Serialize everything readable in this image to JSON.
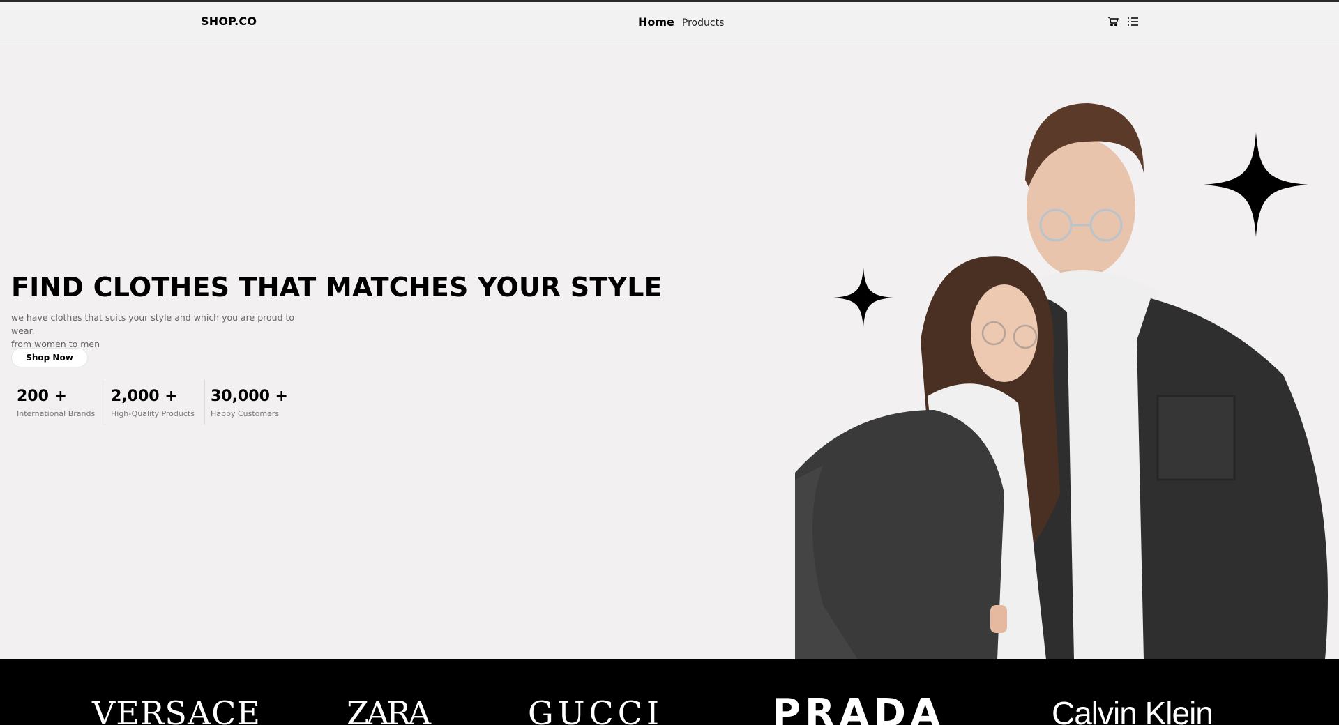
{
  "nav": {
    "brand": "SHOP.CO",
    "links": [
      {
        "label": "Home",
        "active": true
      },
      {
        "label": "Products",
        "active": false
      }
    ],
    "icons": [
      "cart-icon",
      "list-icon"
    ]
  },
  "hero": {
    "title": "FIND CLOTHES THAT MATCHES YOUR STYLE",
    "subtitle_line1": "we have clothes that suits your style and which you are proud to wear.",
    "subtitle_line2": "from women to men",
    "cta_label": "Shop Now",
    "stats": [
      {
        "value": "200 +",
        "label": "International Brands"
      },
      {
        "value": "2,000 +",
        "label": "High-Quality Products"
      },
      {
        "value": "30,000 +",
        "label": "Happy Customers"
      }
    ],
    "decorations": [
      "sparkle-icon",
      "sparkle-icon"
    ]
  },
  "brands": [
    "VERSACE",
    "ZARA",
    "GUCCI",
    "PRADA",
    "Calvin Klein"
  ],
  "colors": {
    "page_bg": "#f2f0f1",
    "nav_bg": "#f2f2f3",
    "brand_bar_bg": "#000000",
    "text_primary": "#000000",
    "text_secondary": "#666666"
  }
}
